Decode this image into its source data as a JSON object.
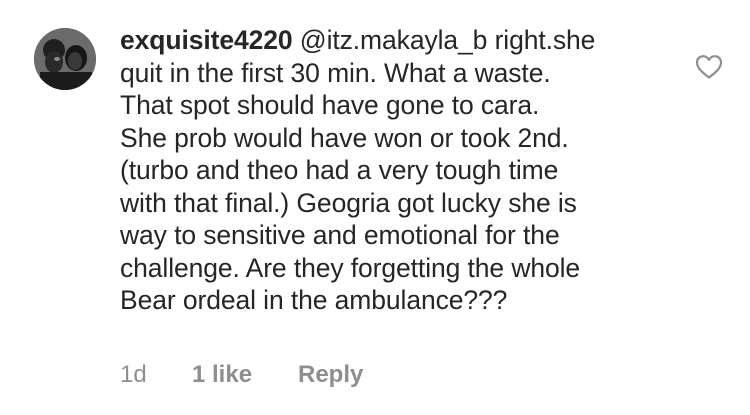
{
  "comment": {
    "username": "exquisite4220",
    "lines": [
      "@itz.makayla_b right.she",
      "quit in the first 30 min. What a waste.",
      "That spot should have gone to cara.",
      "She prob would have won or took 2nd.",
      "(turbo and theo had a very tough time",
      "with that final.) Geogria got lucky she is",
      "way to sensitive and emotional for the",
      "challenge. Are they forgetting the whole",
      "Bear ordeal in the ambulance???"
    ],
    "timestamp": "1d",
    "likes_label": "1 like",
    "reply_label": "Reply"
  },
  "icons": {
    "avatar": "profile-photo",
    "like": "heart-outline-icon"
  },
  "colors": {
    "text": "#262626",
    "meta_text": "#8e8e8e",
    "icon_stroke": "#8e8e8e",
    "background": "#ffffff"
  }
}
